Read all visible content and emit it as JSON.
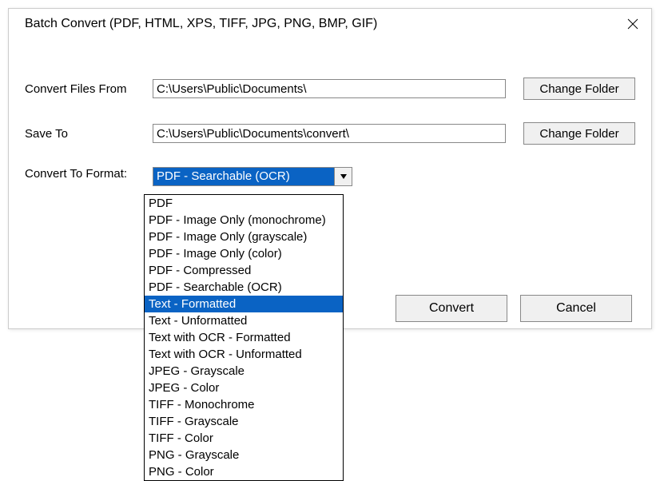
{
  "title": "Batch Convert (PDF, HTML, XPS, TIFF, JPG, PNG, BMP, GIF)",
  "labels": {
    "from": "Convert Files From",
    "saveto": "Save To",
    "format": "Convert To Format:"
  },
  "inputs": {
    "from": "C:\\Users\\Public\\Documents\\",
    "saveto": "C:\\Users\\Public\\Documents\\convert\\"
  },
  "buttons": {
    "change": "Change Folder",
    "convert": "Convert",
    "cancel": "Cancel"
  },
  "combo": {
    "selected": "PDF - Searchable (OCR)"
  },
  "dropdown": {
    "items": [
      "PDF",
      "PDF - Image Only (monochrome)",
      "PDF - Image Only (grayscale)",
      "PDF - Image Only (color)",
      "PDF - Compressed",
      "PDF - Searchable (OCR)",
      "Text - Formatted",
      "Text - Unformatted",
      "Text with OCR - Formatted",
      "Text with OCR - Unformatted",
      "JPEG - Grayscale",
      "JPEG - Color",
      "TIFF - Monochrome",
      "TIFF - Grayscale",
      "TIFF - Color",
      "PNG - Grayscale",
      "PNG - Color"
    ],
    "highlighted_index": 6
  }
}
